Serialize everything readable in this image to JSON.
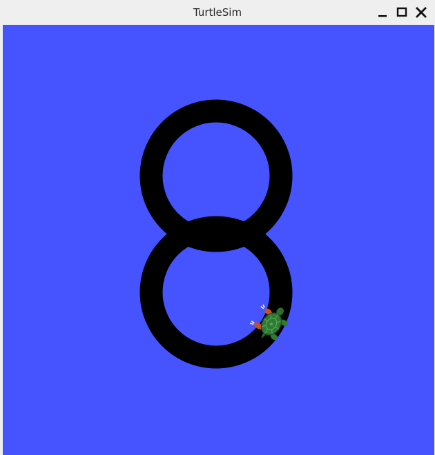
{
  "window": {
    "title": "TurtleSim",
    "controls": {
      "minimize_icon": "minimize-icon",
      "maximize_icon": "maximize-icon",
      "close_icon": "close-icon"
    }
  },
  "canvas": {
    "background_color": "#4554ff",
    "pen_color": "#000000"
  },
  "turtle": {
    "icon": "turtle-icon",
    "shell_color": "#2f7a32"
  }
}
